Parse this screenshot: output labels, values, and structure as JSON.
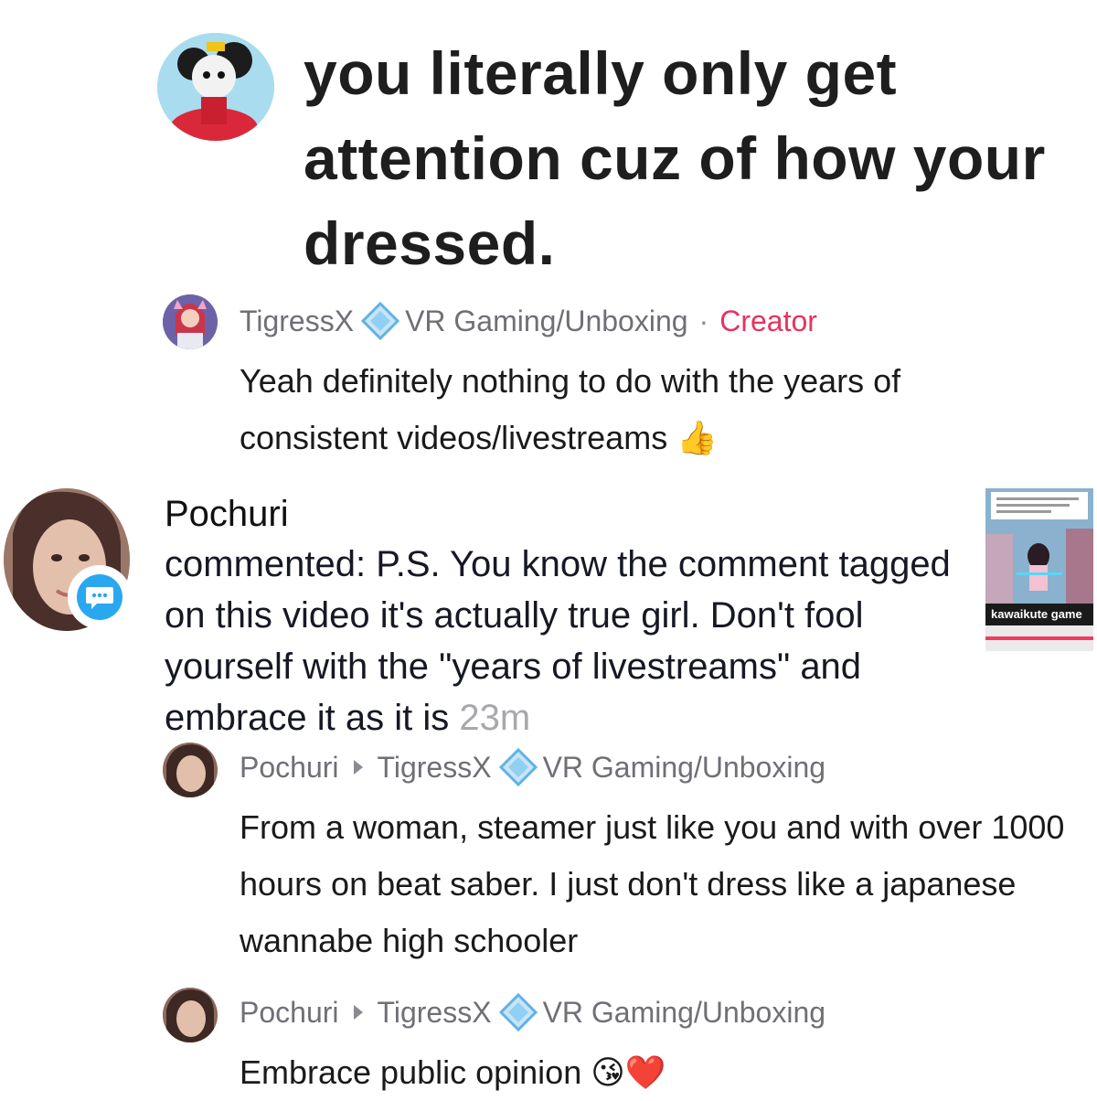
{
  "quoted_comment": {
    "text": "you literally only get attention cuz of how your dressed."
  },
  "creator_reply": {
    "username": "TigressX",
    "verified_icon": "diamond-badge-icon",
    "subtitle": "VR Gaming/Unboxing",
    "separator": "·",
    "role": "Creator",
    "text": "Yeah definitely nothing to do with the years of consistent videos/livestreams",
    "emoji": "👍"
  },
  "notification": {
    "username": "Pochuri",
    "badge_icon": "chat-bubble-icon",
    "text": "commented: P.S. You know the comment tagged on this video it's actually true girl. Don't fool yourself with the \"years of livestreams\" and embrace it as it is",
    "time": "23m",
    "video_caption": "kawaikute game"
  },
  "replies": [
    {
      "from": "Pochuri",
      "to": "TigressX",
      "to_subtitle": "VR Gaming/Unboxing",
      "text": "From a woman, steamer just like you and with over 1000 hours on beat saber. I just don't dress like a japanese wannabe high schooler"
    },
    {
      "from": "Pochuri",
      "to": "TigressX",
      "to_subtitle": "VR Gaming/Unboxing",
      "text": "Embrace public opinion",
      "emoji": "😘❤️"
    }
  ],
  "colors": {
    "creator": "#e8325c",
    "badge_blue": "#29a8f0",
    "meta_gray": "#6f6f76",
    "time_gray": "#a7a8ac"
  }
}
